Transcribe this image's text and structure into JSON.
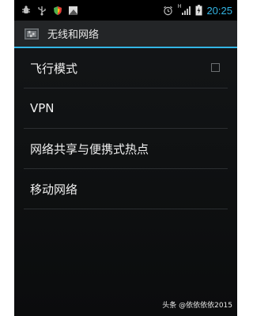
{
  "status_bar": {
    "left_icons": [
      "usb-debug-icon",
      "usb-icon",
      "shield-icon",
      "photo-icon"
    ],
    "right_icons": [
      "alarm-icon",
      "signal-icon",
      "battery-icon"
    ],
    "network_label": "H",
    "time": "20:25",
    "time_color": "#33b5e5"
  },
  "action_bar": {
    "icon": "settings-app-icon",
    "title": "无线和网络",
    "accent_color": "#33b5e5"
  },
  "settings": {
    "items": [
      {
        "label": "飞行模式",
        "has_checkbox": true,
        "checked": false
      },
      {
        "label": "VPN"
      },
      {
        "label": "网络共享与便携式热点"
      },
      {
        "label": "移动网络"
      }
    ]
  },
  "watermark": "头条 @依依依依2015"
}
